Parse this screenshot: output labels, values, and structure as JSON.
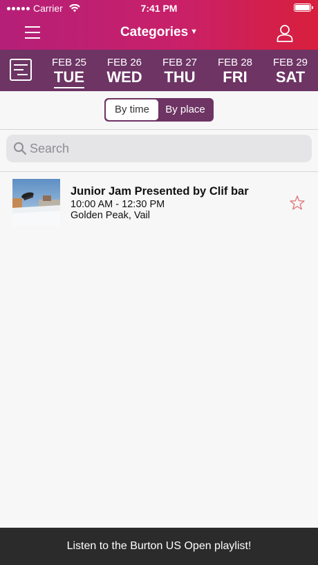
{
  "status": {
    "carrier": "Carrier",
    "time": "7:41 PM"
  },
  "nav": {
    "title": "Categories"
  },
  "dates": [
    {
      "date": "FEB 25",
      "weekday": "TUE",
      "selected": true
    },
    {
      "date": "FEB 26",
      "weekday": "WED",
      "selected": false
    },
    {
      "date": "FEB 27",
      "weekday": "THU",
      "selected": false
    },
    {
      "date": "FEB 28",
      "weekday": "FRI",
      "selected": false
    },
    {
      "date": "FEB 29",
      "weekday": "SAT",
      "selected": false
    }
  ],
  "segment": {
    "by_time": "By time",
    "by_place": "By place",
    "selected": "By time"
  },
  "search": {
    "placeholder": "Search"
  },
  "events": [
    {
      "title": "Junior Jam Presented by Clif bar",
      "time": "10:00 AM - 12:30 PM",
      "place": "Golden Peak, Vail",
      "favorite": false
    }
  ],
  "footer": {
    "text": "Listen to the Burton US Open playlist!"
  },
  "colors": {
    "header_gradient_start": "#b51f78",
    "header_gradient_end": "#d81f3c",
    "datebar": "#6d3464",
    "star": "#e07a7a",
    "footer": "#2b2b2b"
  }
}
